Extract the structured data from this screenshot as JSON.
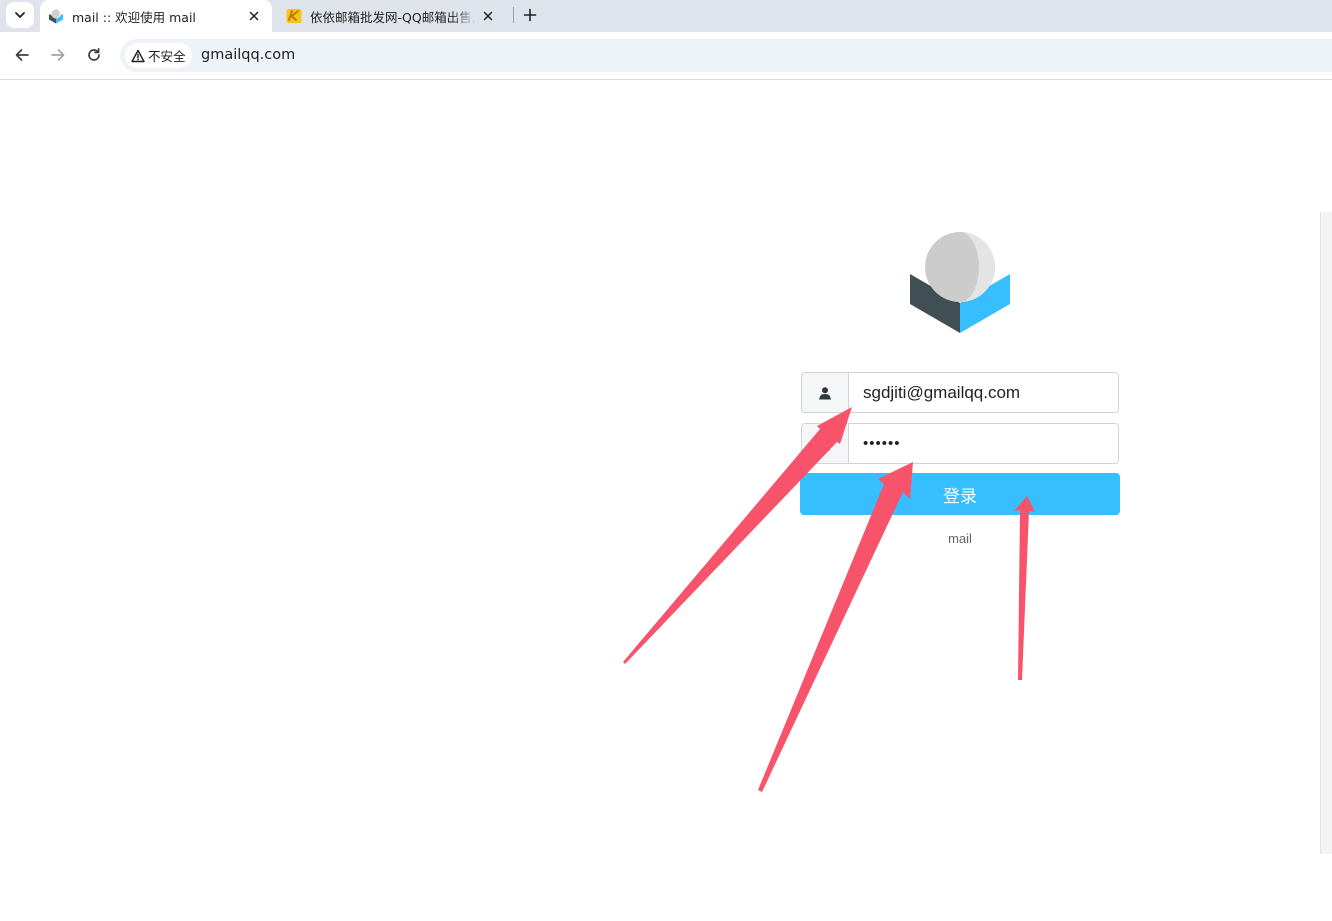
{
  "browser": {
    "tabs": [
      {
        "title": "mail :: 欢迎使用 mail",
        "active": true,
        "favicon": "roundcube-icon"
      },
      {
        "title": "依依邮箱批发网-QQ邮箱出售,QQ",
        "active": false,
        "favicon": "k-logo-icon"
      }
    ],
    "address_bar": {
      "security_label": "不安全",
      "url": "gmailqq.com"
    }
  },
  "login": {
    "username_value": "sgdjiti@gmailqq.com",
    "password_value": "••••••",
    "submit_label": "登录",
    "product_name": "mail"
  },
  "colors": {
    "accent": "#37beff",
    "annotation_arrow": "#f7536a",
    "logo_dark": "#404f54",
    "logo_light": "#37beff"
  }
}
